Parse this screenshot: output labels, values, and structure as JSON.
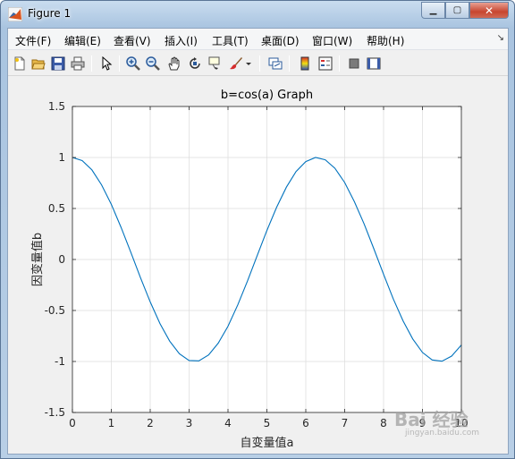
{
  "window": {
    "title": "Figure 1",
    "buttons": {
      "minimize": "▁",
      "maximize": "▢",
      "close": "✕"
    }
  },
  "menubar": {
    "items": [
      {
        "label": "文件(F)",
        "key": "file"
      },
      {
        "label": "编辑(E)",
        "key": "edit"
      },
      {
        "label": "查看(V)",
        "key": "view"
      },
      {
        "label": "插入(I)",
        "key": "insert"
      },
      {
        "label": "工具(T)",
        "key": "tools"
      },
      {
        "label": "桌面(D)",
        "key": "desktop"
      },
      {
        "label": "窗口(W)",
        "key": "window"
      },
      {
        "label": "帮助(H)",
        "key": "help"
      }
    ],
    "dock_glyph": "↘"
  },
  "toolbar": {
    "tools": [
      "new-figure-icon",
      "open-file-icon",
      "save-icon",
      "print-icon",
      "edit-plot-arrow-icon",
      "zoom-in-icon",
      "zoom-out-icon",
      "pan-hand-icon",
      "rotate-3d-icon",
      "data-cursor-icon",
      "brush-icon",
      "brush-dropdown-icon",
      "link-plot-icon",
      "insert-colorbar-icon",
      "insert-legend-icon",
      "hide-plot-tools-icon",
      "show-plot-tools-icon"
    ]
  },
  "chart_data": {
    "type": "line",
    "title": "b=cos(a) Graph",
    "xlabel": "自变量值a",
    "ylabel": "因变量值b",
    "xlim": [
      0,
      10
    ],
    "ylim": [
      -1.5,
      1.5
    ],
    "xticks": [
      "0",
      "1",
      "2",
      "3",
      "4",
      "5",
      "6",
      "7",
      "8",
      "9",
      "10"
    ],
    "yticks": [
      "1.5",
      "1",
      "0.5",
      "0",
      "-0.5",
      "-1",
      "-1.5"
    ],
    "grid": true,
    "series": [
      {
        "color": "#0072bd",
        "x": [
          0,
          0.25,
          0.5,
          0.75,
          1,
          1.25,
          1.5,
          1.75,
          2,
          2.25,
          2.5,
          2.75,
          3,
          3.25,
          3.5,
          3.75,
          4,
          4.25,
          4.5,
          4.75,
          5,
          5.25,
          5.5,
          5.75,
          6,
          6.25,
          6.5,
          6.75,
          7,
          7.25,
          7.5,
          7.75,
          8,
          8.25,
          8.5,
          8.75,
          9,
          9.25,
          9.5,
          9.75,
          10
        ],
        "y": [
          1,
          0.969,
          0.878,
          0.732,
          0.54,
          0.315,
          0.071,
          -0.178,
          -0.416,
          -0.628,
          -0.801,
          -0.924,
          -0.99,
          -0.994,
          -0.936,
          -0.82,
          -0.654,
          -0.446,
          -0.211,
          0.037,
          0.284,
          0.512,
          0.709,
          0.862,
          0.96,
          1.0,
          0.977,
          0.894,
          0.754,
          0.566,
          0.347,
          0.105,
          -0.146,
          -0.388,
          -0.602,
          -0.779,
          -0.911,
          -0.985,
          -0.997,
          -0.947,
          -0.839
        ]
      }
    ]
  },
  "watermark": {
    "text": "Bai 经验",
    "sub": "jingyan.baidu.com"
  }
}
